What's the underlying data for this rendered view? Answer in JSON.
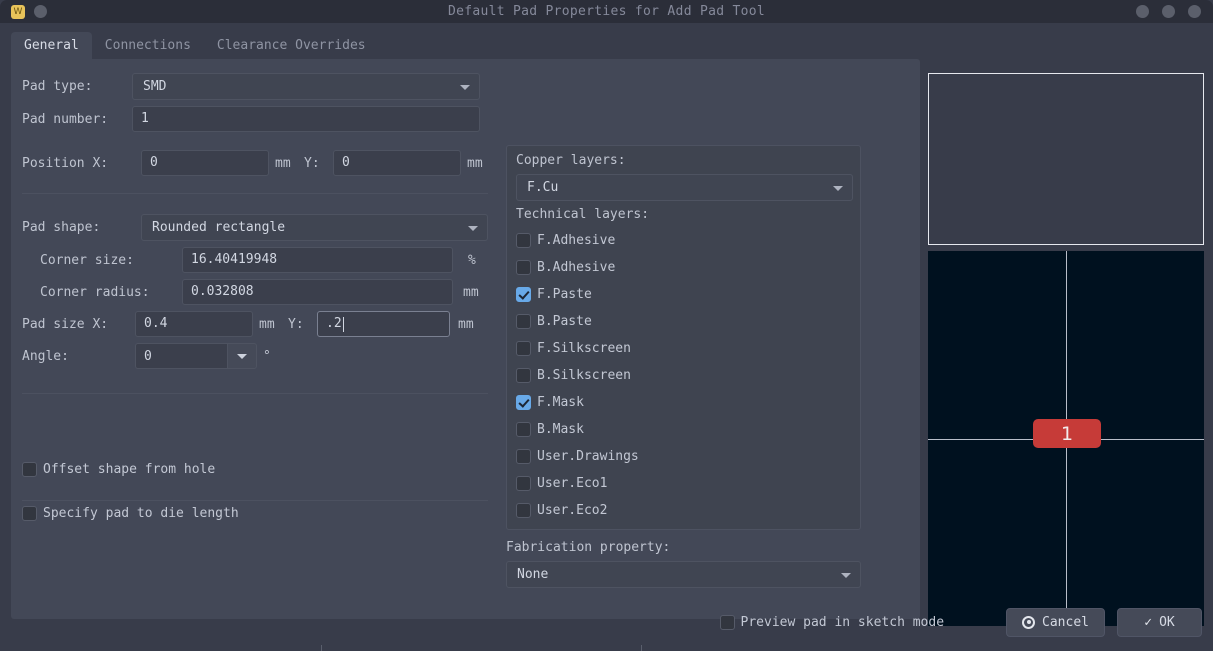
{
  "window": {
    "title": "Default Pad Properties for Add Pad Tool",
    "badge_letter": "W"
  },
  "tabs": [
    {
      "label": "General",
      "active": true
    },
    {
      "label": "Connections",
      "active": false
    },
    {
      "label": "Clearance Overrides",
      "active": false
    }
  ],
  "general": {
    "pad_type_label": "Pad type:",
    "pad_type_value": "SMD",
    "pad_number_label": "Pad number:",
    "pad_number_value": "1",
    "position_x_label": "Position X:",
    "position_x_value": "0",
    "position_x_unit": "mm",
    "position_y_label": "Y:",
    "position_y_value": "0",
    "position_y_unit": "mm",
    "pad_shape_label": "Pad shape:",
    "pad_shape_value": "Rounded rectangle",
    "corner_size_label": "Corner size:",
    "corner_size_value": "16.40419948",
    "corner_size_unit": "%",
    "corner_radius_label": "Corner radius:",
    "corner_radius_value": "0.032808",
    "corner_radius_unit": "mm",
    "pad_size_x_label": "Pad size X:",
    "pad_size_x_value": "0.4",
    "pad_size_x_unit": "mm",
    "pad_size_y_label": "Y:",
    "pad_size_y_value": ".2",
    "pad_size_y_unit": "mm",
    "angle_label": "Angle:",
    "angle_value": "0",
    "angle_unit": "°",
    "offset_shape_label": "Offset shape from hole",
    "offset_shape_checked": false,
    "die_length_label": "Specify pad to die length",
    "die_length_checked": false
  },
  "layers": {
    "copper_label": "Copper layers:",
    "copper_value": "F.Cu",
    "technical_label": "Technical layers:",
    "items": [
      {
        "label": "F.Adhesive",
        "checked": false
      },
      {
        "label": "B.Adhesive",
        "checked": false
      },
      {
        "label": "F.Paste",
        "checked": true
      },
      {
        "label": "B.Paste",
        "checked": false
      },
      {
        "label": "F.Silkscreen",
        "checked": false
      },
      {
        "label": "B.Silkscreen",
        "checked": false
      },
      {
        "label": "F.Mask",
        "checked": true
      },
      {
        "label": "B.Mask",
        "checked": false
      },
      {
        "label": "User.Drawings",
        "checked": false
      },
      {
        "label": "User.Eco1",
        "checked": false
      },
      {
        "label": "User.Eco2",
        "checked": false
      }
    ],
    "fabrication_label": "Fabrication property:",
    "fabrication_value": "None"
  },
  "preview": {
    "pad_number": "1",
    "pad_color": "#c63b38",
    "canvas_color": "#00111f",
    "crosshair_color": "#b9bec9"
  },
  "footer": {
    "sketch_label": "Preview pad in sketch mode",
    "sketch_checked": false,
    "cancel_label": "Cancel",
    "ok_label": "OK",
    "ok_icon": "✓"
  }
}
